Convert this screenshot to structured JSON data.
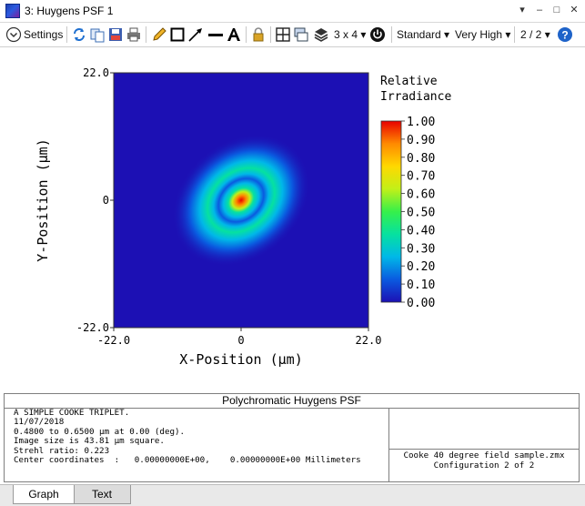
{
  "window": {
    "title": "3: Huygens PSF 1",
    "controls": [
      "▾",
      "–",
      "□",
      "✕"
    ]
  },
  "toolbar": {
    "settings_label": "Settings",
    "layout_label": "3 x 4",
    "sampling_label": "Standard",
    "quality_label": "Very High",
    "page_label": "2 / 2"
  },
  "chart_data": {
    "type": "heatmap",
    "title": "",
    "xlabel": "X-Position (µm)",
    "ylabel": "Y-Position (µm)",
    "xlim": [
      -22.0,
      22.0
    ],
    "ylim": [
      -22.0,
      22.0
    ],
    "x_ticks": [
      "-22.0",
      "0",
      "22.0"
    ],
    "y_ticks": [
      "22.0",
      "0",
      "-22.0"
    ],
    "colorbar_title": [
      "Relative",
      "Irradiance"
    ],
    "colorbar_range": [
      0.0,
      1.0
    ],
    "colorbar_ticks": [
      "1.00",
      "0.90",
      "0.80",
      "0.70",
      "0.60",
      "0.50",
      "0.40",
      "0.30",
      "0.20",
      "0.10",
      "0.00"
    ],
    "peak_value": 1.0,
    "peak_at": [
      0,
      0
    ],
    "colormap": [
      "#1c10b4",
      "#0a5ae0",
      "#00b8e8",
      "#06e1a0",
      "#36f04a",
      "#c2f018",
      "#ffd800",
      "#ff8a00",
      "#e80000"
    ],
    "grid": false,
    "legend": "right"
  },
  "report": {
    "title": "Polychromatic Huygens PSF",
    "lines": [
      "A SIMPLE COOKE TRIPLET.",
      "11/07/2018",
      "0.4800 to 0.6500 µm at 0.00 (deg).",
      "Image size is 43.81 µm square.",
      "Strehl ratio: 0.223",
      "Center coordinates  :   0.00000000E+00,    0.00000000E+00 Millimeters"
    ],
    "file": "Cooke 40 degree field sample.zmx",
    "config": "Configuration 2 of 2"
  },
  "tabs": {
    "graph": "Graph",
    "text": "Text"
  }
}
